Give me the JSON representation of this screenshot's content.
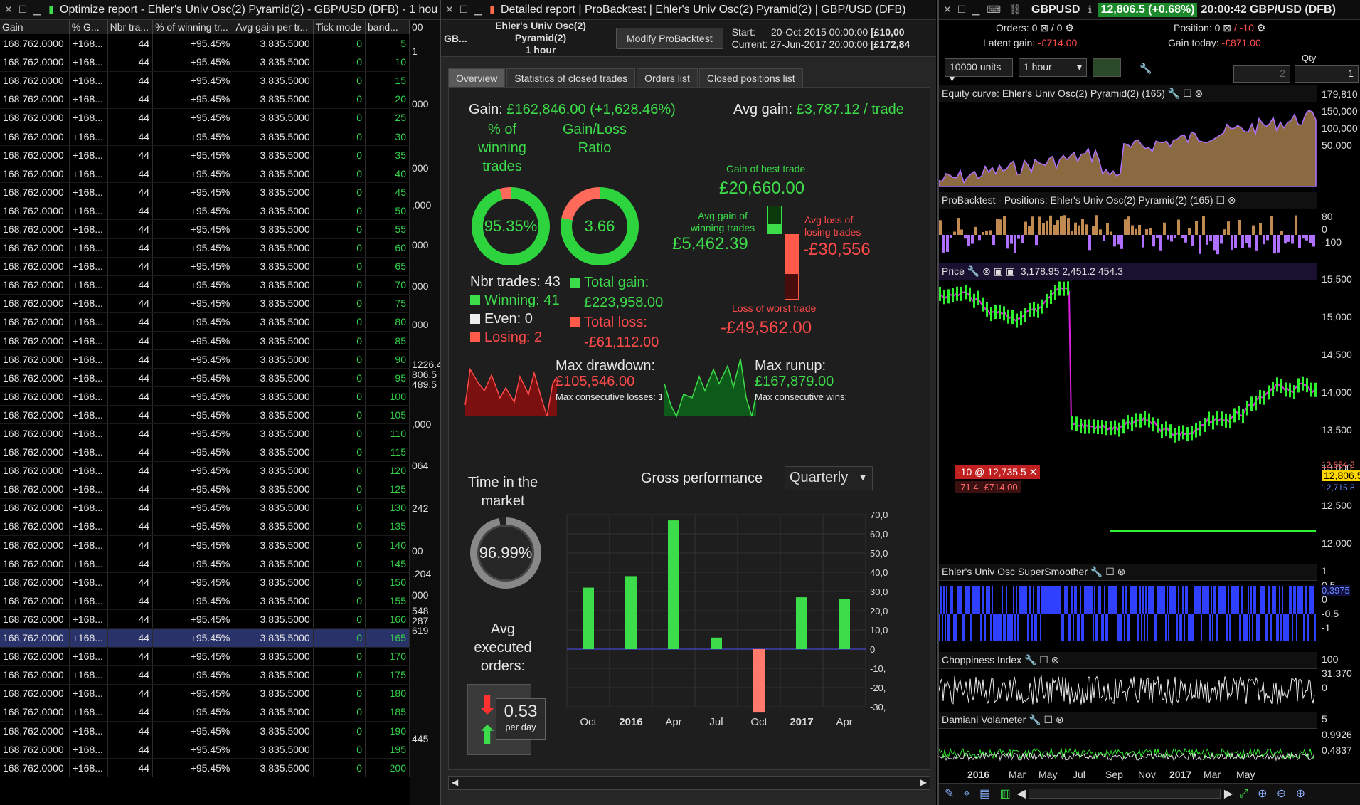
{
  "optimize": {
    "title": "Optimize report - Ehler's Univ Osc(2) Pyramid(2) - GBP/USD (DFB) - 1 hou",
    "columns": [
      "Gain",
      "% G...",
      "Nbr tra...",
      "% of winning tr...",
      "Avg gain per tr...",
      "Tick mode",
      "band..."
    ],
    "row_common": {
      "gain": "168,762.0000",
      "g": "+168...",
      "nbr": "44",
      "win": "+95.45%",
      "avg": "3,835.5000",
      "tick": "0"
    },
    "bands": [
      5,
      10,
      15,
      20,
      25,
      30,
      35,
      40,
      45,
      50,
      55,
      60,
      65,
      70,
      75,
      80,
      85,
      90,
      95,
      100,
      105,
      110,
      115,
      120,
      125,
      130,
      135,
      140,
      145,
      150,
      155,
      160,
      165,
      170,
      175,
      180,
      185,
      190,
      195,
      200
    ],
    "selected_band": 165,
    "gutter_labels": [
      "00",
      "1",
      "000",
      "000",
      ",000",
      "000",
      "000",
      "000",
      "1226.4",
      "806.5",
      "489.5",
      ",000",
      "064",
      "242",
      "00",
      ".204",
      "000",
      "548",
      "287",
      "619",
      "445"
    ]
  },
  "detailed": {
    "title": "Detailed report | ProBacktest | Ehler's Univ Osc(2) Pyramid(2) | GBP/USD (DFB)",
    "sub_instrument": "GB...",
    "strategy": "Ehler's Univ Osc(2) Pyramid(2)",
    "timeframe": "1 hour",
    "modify_button": "Modify ProBacktest",
    "start_label": "Start:",
    "start": "20-Oct-2015 00:00:00",
    "start_val": "[£10,00",
    "current_label": "Current:",
    "current": "27-Jun-2017 20:00:00",
    "current_val": "[£172,84",
    "tabs": [
      "Overview",
      "Statistics of closed trades",
      "Orders list",
      "Closed positions list"
    ],
    "gain_label": "Gain:",
    "gain_value": "£162,846.00 (+1,628.46%)",
    "avg_gain_label": "Avg gain:",
    "avg_gain_value": "£3,787.12 / trade",
    "pct_winning_label": "% of winning trades",
    "pct_winning": "95.35%",
    "pct_winning_fraction": 0.9535,
    "gl_ratio_label": "Gain/Loss Ratio",
    "gl_ratio": "3.66",
    "gl_fraction": 0.785,
    "nbr_trades": "Nbr trades: 43",
    "winning": "Winning: 41",
    "even": "Even: 0",
    "losing": "Losing: 2",
    "total_gain_label": "Total gain:",
    "total_gain": "£223,958.00",
    "total_loss_label": "Total loss:",
    "total_loss": "-£61,112.00",
    "best_trade_label": "Gain of best trade",
    "best_trade": "£20,660.00",
    "avg_win_label": "Avg gain of winning trades",
    "avg_win": "£5,462.39",
    "avg_loss_label": "Avg loss of losing trades",
    "avg_loss": "-£30,556",
    "worst_trade_label": "Loss of worst trade",
    "worst_trade": "-£49,562.00",
    "max_dd_label": "Max drawdown:",
    "max_dd": "£105,546.00",
    "max_consec_losses": "Max consecutive losses: 1",
    "max_runup_label": "Max runup:",
    "max_runup": "£167,879.00",
    "max_consec_wins": "Max consecutive wins:",
    "time_market_label": "Time in the market",
    "time_market": "96.99%",
    "time_market_fraction": 0.9699,
    "avg_orders_label": "Avg executed orders:",
    "avg_orders": "0.53",
    "per_day": "per day",
    "gross_perf_label": "Gross performance",
    "period": "Quarterly",
    "colors": {
      "green": "#3ddc4a",
      "red": "#ff4a4a"
    }
  },
  "chart_data": {
    "type": "bar",
    "categories": [
      "Oct",
      "Jan",
      "Apr",
      "Jul",
      "Oct",
      "Jan",
      "Apr"
    ],
    "category_labels": [
      "Oct",
      "2016",
      "Apr",
      "Jul",
      "Oct",
      "2017",
      "Apr"
    ],
    "values": [
      32000,
      38000,
      67000,
      6000,
      -33000,
      27000,
      26000
    ],
    "ylim": [
      -30000,
      70000
    ],
    "yticks": [
      "70,0",
      "60,0",
      "50,0",
      "40,0",
      "30,0",
      "20,0",
      "10,0",
      "0",
      "-10,",
      "-20,",
      "-30,"
    ]
  },
  "chartwin": {
    "symbol": "GBPUSD",
    "price_badge": "12,806.5 (+0.68%)",
    "clock": "20:00:42 GBP/USD (DFB)",
    "orders": "Orders: 0",
    "orders2": "/ 0",
    "position": "Position: 0",
    "position2": "/ -10",
    "latent_label": "Latent gain:",
    "latent": "-£714.00",
    "today_label": "Gain today:",
    "today": "-£871.00",
    "units": "10000 units",
    "interval": "1 hour",
    "qty_label": "Qty",
    "qty": "1",
    "qty2": "2",
    "equity_title": "Equity curve: Ehler's Univ Osc(2) Pyramid(2) (165)",
    "equity_ticks": [
      "179,810",
      "150,000",
      "100,000",
      "50,000"
    ],
    "positions_title": "ProBacktest - Positions: Ehler's Univ Osc(2) Pyramid(2) (165)",
    "positions_ticks": [
      "80",
      "0",
      "-100"
    ],
    "price_title": "Price",
    "price_strip": "3,178.95   2,451.2   454.3",
    "price_ticks": [
      "15,500",
      "15,000",
      "14,500",
      "14,000",
      "13,500",
      "13,000",
      "12,500",
      "12,000"
    ],
    "last_price": "12,806.5",
    "price2": "12,854.2",
    "price3": "12,715.8",
    "order_tag": "-10 @ 12,735.5",
    "order_pl": "-71.4  -£714.00",
    "osc_title": "Ehler's Univ Osc SuperSmoother",
    "osc_ticks": [
      "1",
      "0.5",
      "0",
      "-0.5",
      "-1"
    ],
    "osc_val": "0.3975",
    "chop_title": "Choppiness Index",
    "chop_ticks": [
      "100",
      "31.370",
      "0"
    ],
    "dv_title": "Damiani Volameter",
    "dv_ticks": [
      "5",
      "0.9926",
      "0.4837"
    ],
    "xaxis": [
      "2016",
      "Mar",
      "May",
      "Jul",
      "Sep",
      "Nov",
      "2017",
      "Mar",
      "May"
    ]
  }
}
